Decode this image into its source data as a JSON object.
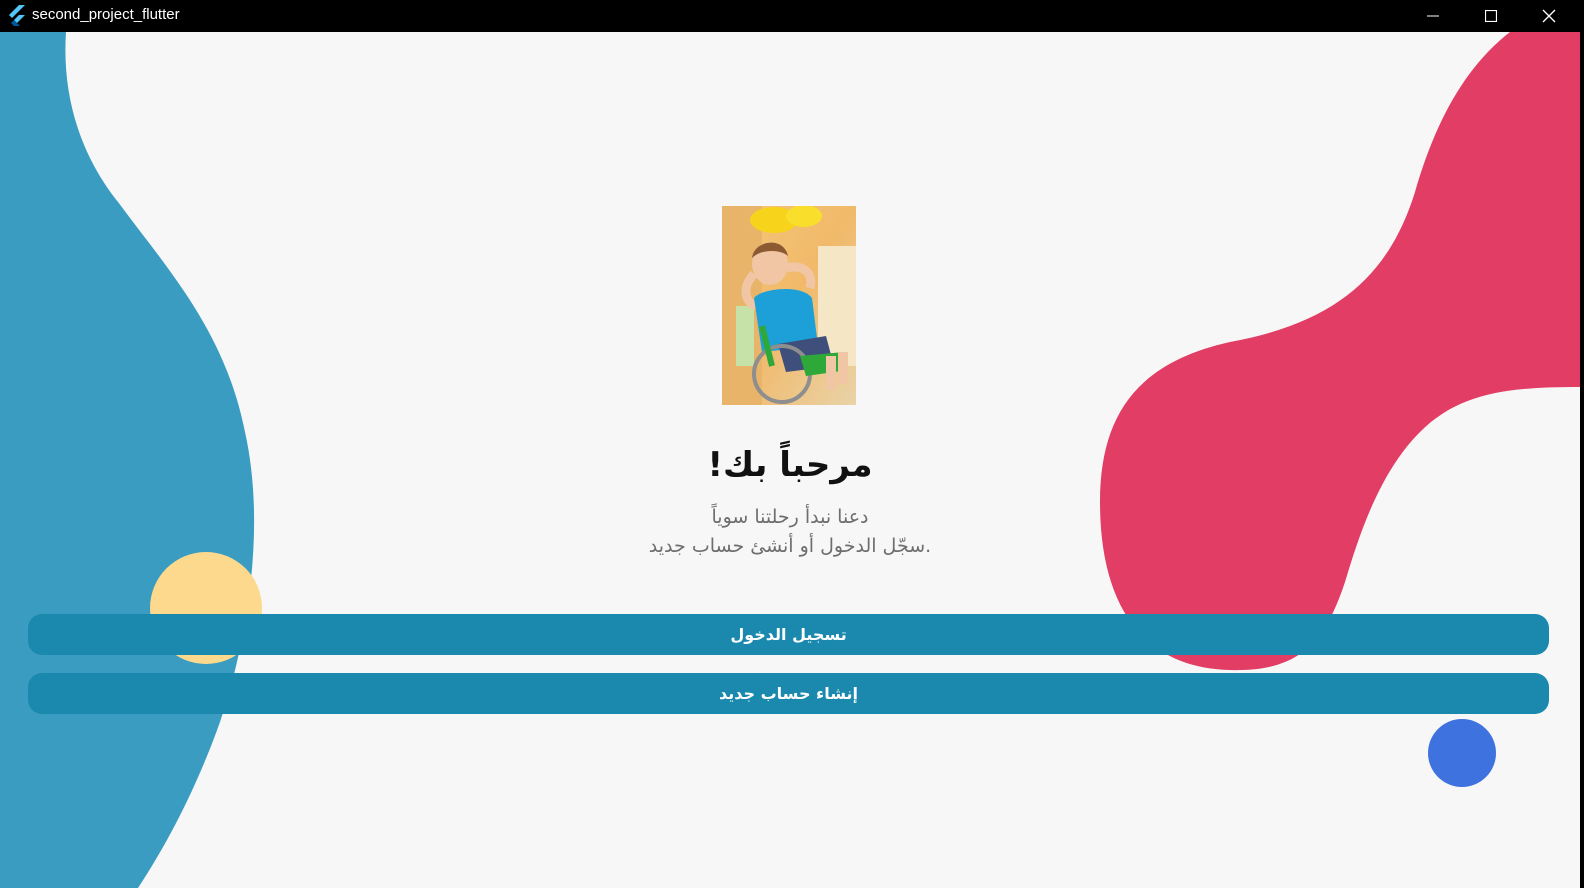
{
  "window": {
    "title": "second_project_flutter",
    "app_icon": "flutter-logo-icon",
    "controls": {
      "minimize_icon": "minimize-icon",
      "maximize_icon": "maximize-icon",
      "close_icon": "close-icon"
    }
  },
  "main": {
    "hero_image": "child-in-wheelchair-photo",
    "title": "مرحباً بك!",
    "subtitle_line1": "دعنا نبدأ رحلتنا سوياً",
    "subtitle_line2": "سجّل الدخول أو أنشئ حساب جديد.",
    "login_label": "تسجيل الدخول",
    "signup_label": "إنشاء حساب جديد"
  },
  "colors": {
    "background": "#f7f7f7",
    "blue_blob": "#3b9cc1",
    "red_blob": "#e23d64",
    "yellow_circle": "#fcd98d",
    "blue_circle": "#3d72df",
    "button": "#1a89ad",
    "button_text": "#ffffff",
    "title": "#111111",
    "subtitle": "#6e6e6e"
  }
}
